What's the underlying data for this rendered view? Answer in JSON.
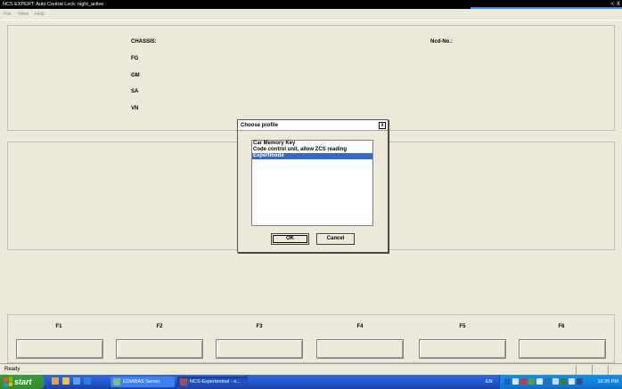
{
  "window": {
    "title": "NCS EXPERT: Auto Central Lock: night_active",
    "controls": [
      "<",
      "X"
    ]
  },
  "menu": [
    "File",
    "View",
    "Help"
  ],
  "info": {
    "chassis_label": "CHASSIS:",
    "fg_label": "FG",
    "gm_label": "GM",
    "sa_label": "SA",
    "vn_label": "VN",
    "ncd_label": "Ncd-No.:"
  },
  "fkeys": [
    "F1",
    "F2",
    "F3",
    "F4",
    "F5",
    "F6"
  ],
  "status": {
    "text": "Ready"
  },
  "dialog": {
    "title": "Choose profile",
    "close": "x",
    "items": [
      "Car Memory Key",
      "Code control unit, allow ZCS reading",
      "Expertmode"
    ],
    "selected_index": 2,
    "ok_label": "OK",
    "cancel_label": "Cancel"
  },
  "taskbar": {
    "start_label": "start",
    "tasks": [
      "EDIABAS Server",
      "NCS-Expertentool - n..."
    ],
    "lang": "EN",
    "clock": "10:20 PM"
  },
  "colors": {
    "selection": "#316ac5",
    "taskbar": "#245edb",
    "start": "#3c9c3c"
  }
}
